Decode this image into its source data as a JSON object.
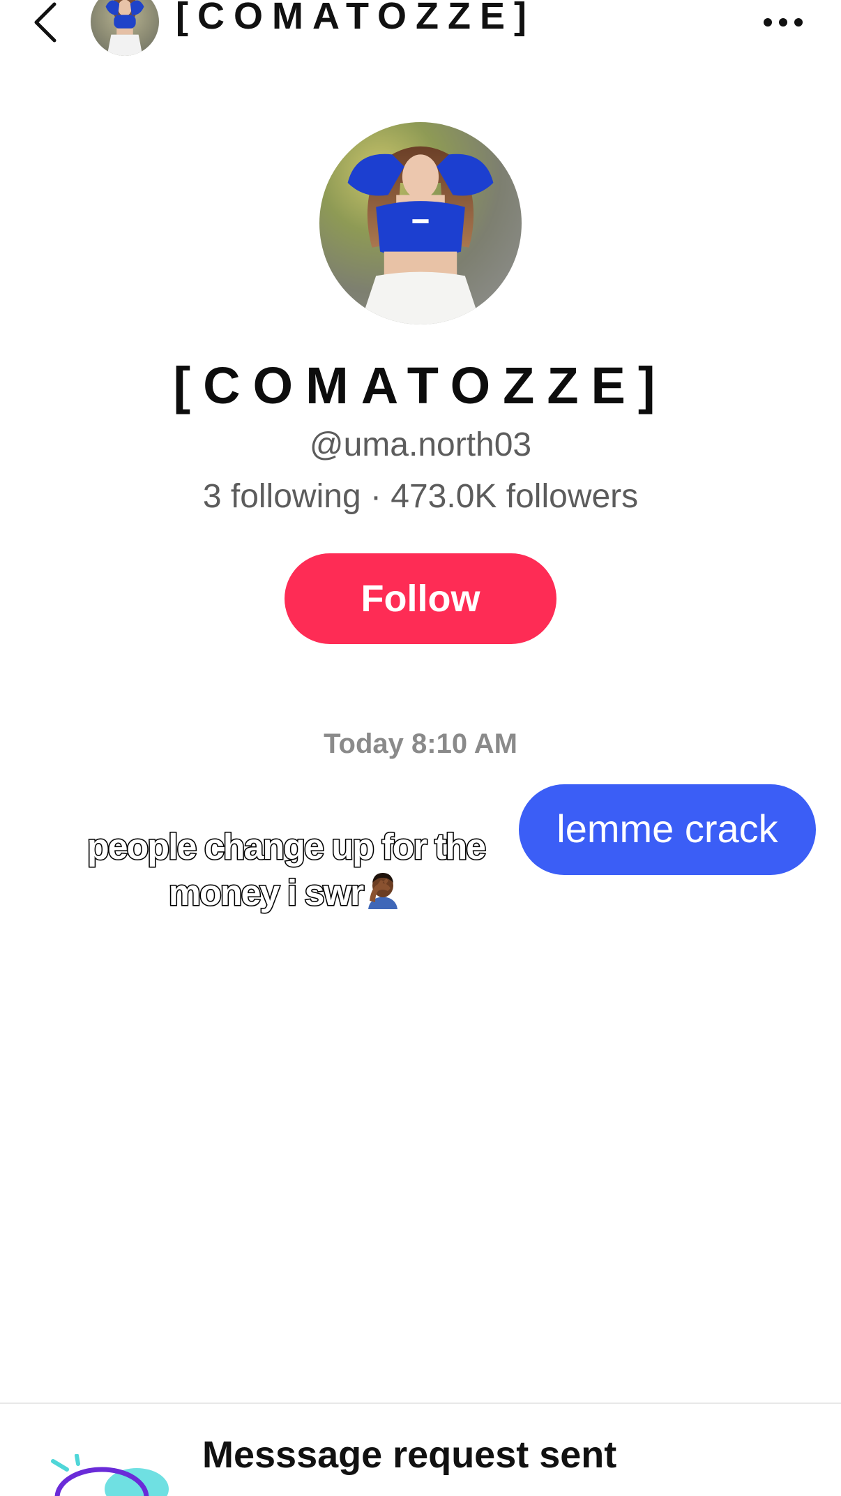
{
  "header": {
    "title": "[COMATOZZE]",
    "back_icon": "chevron-left-icon",
    "more_icon": "more-horizontal-icon"
  },
  "profile": {
    "name": "[COMATOZZE]",
    "handle": "@uma.north03",
    "stats": "3 following · 473.0K followers",
    "follow_label": "Follow"
  },
  "chat": {
    "timestamp": "Today 8:10 AM",
    "outgoing_message": "lemme crack",
    "sticker_caption": "people change up for the money i swr",
    "sticker_emoji_icon": "man-facepalming-icon"
  },
  "request_panel": {
    "title": "Messsage request sent"
  },
  "colors": {
    "follow_button": "#fe2c55",
    "outgoing_bubble": "#3b5ef6",
    "secondary_text": "#5c5c5c",
    "timestamp_text": "#8a8a8a"
  }
}
